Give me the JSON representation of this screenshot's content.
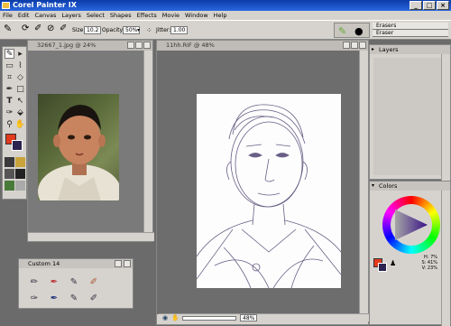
{
  "app": {
    "title": "Corel Painter IX"
  },
  "menu": [
    "File",
    "Edit",
    "Canvas",
    "Layers",
    "Select",
    "Shapes",
    "Effects",
    "Movie",
    "Window",
    "Help"
  ],
  "window_buttons": [
    "_",
    "□",
    "×"
  ],
  "properties": {
    "size_label": "Size",
    "size_value": "10.2",
    "opacity_label": "Opacity:",
    "opacity_value": "50%",
    "jitter_label": "Jitter:",
    "jitter_value": "1.00",
    "brush_category": "Erasers",
    "brush_variant": "Eraser"
  },
  "documents": [
    {
      "title": "32667_1.jpg @ 24%"
    },
    {
      "title": "11hh.RIF @ 48%"
    }
  ],
  "custom_palette": {
    "title": "Custom 14"
  },
  "layers_panel": {
    "title": "Layers"
  },
  "colors_panel": {
    "title": "Colors",
    "hsv": [
      "H: 7%",
      "S: 41%",
      "V: 23%"
    ]
  },
  "zoom": {
    "value": "48%"
  },
  "colors": {
    "main": "#e23a1c",
    "additional": "#2c2350",
    "title_bar": "#0b3ba8",
    "chrome": "#d6d3ce"
  }
}
